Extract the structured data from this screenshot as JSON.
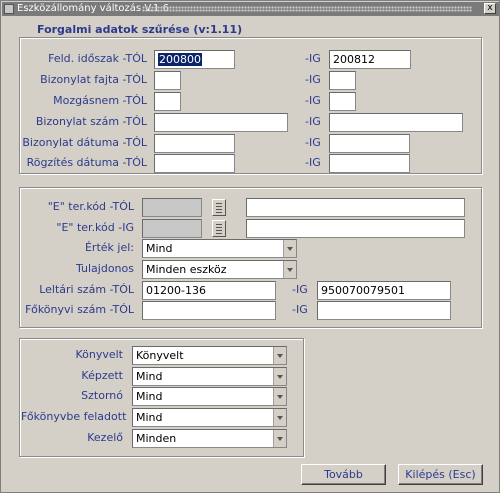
{
  "window": {
    "title": "Eszközállomány változás V.1.6",
    "close_glyph": "x"
  },
  "group1": {
    "title": "Forgalmi adatok szűrése (v:1.11)",
    "rows": [
      {
        "label": "Feld. időszak -TÓL",
        "from_value": "200800",
        "to_label": "-IG",
        "to_value": "200812"
      },
      {
        "label": "Bizonylat fajta -TÓL",
        "from_value": "",
        "to_label": "-IG",
        "to_value": ""
      },
      {
        "label": "Mozgásnem -TÓL",
        "from_value": "",
        "to_label": "-IG",
        "to_value": ""
      },
      {
        "label": "Bizonylat szám -TÓL",
        "from_value": "",
        "to_label": "-IG",
        "to_value": ""
      },
      {
        "label": "Bizonylat dátuma -TÓL",
        "from_value": "",
        "to_label": "-IG",
        "to_value": ""
      },
      {
        "label": "Rögzítés dátuma -TÓL",
        "from_value": "",
        "to_label": "-IG",
        "to_value": ""
      }
    ]
  },
  "group2": {
    "e_ter_tol": {
      "label": "\"E\" ter.kód -TÓL",
      "value": "",
      "desc": ""
    },
    "e_ter_ig": {
      "label": "\"E\" ter.kód -IG",
      "value": "",
      "desc": ""
    },
    "ertek_jel": {
      "label": "Érték jel:",
      "value": "Mind"
    },
    "tulajdonos": {
      "label": "Tulajdonos",
      "value": "Minden eszköz"
    },
    "leltari": {
      "label": "Leltári szám -TÓL",
      "from_value": "01200-136",
      "to_label": "-IG",
      "to_value": "950070079501"
    },
    "fokonyvi": {
      "label": "Főkönyvi szám -TÓL",
      "from_value": "",
      "to_label": "-IG",
      "to_value": ""
    }
  },
  "group3": {
    "rows": [
      {
        "label": "Könyvelt",
        "value": "Könyvelt"
      },
      {
        "label": "Képzett",
        "value": "Mind"
      },
      {
        "label": "Sztornó",
        "value": "Mind"
      },
      {
        "label": "Főkönyvbe feladott",
        "value": "Mind"
      },
      {
        "label": "Kezelő",
        "value": "Minden"
      }
    ]
  },
  "buttons": {
    "next": "Tovább",
    "exit": "Kilépés (Esc)"
  }
}
